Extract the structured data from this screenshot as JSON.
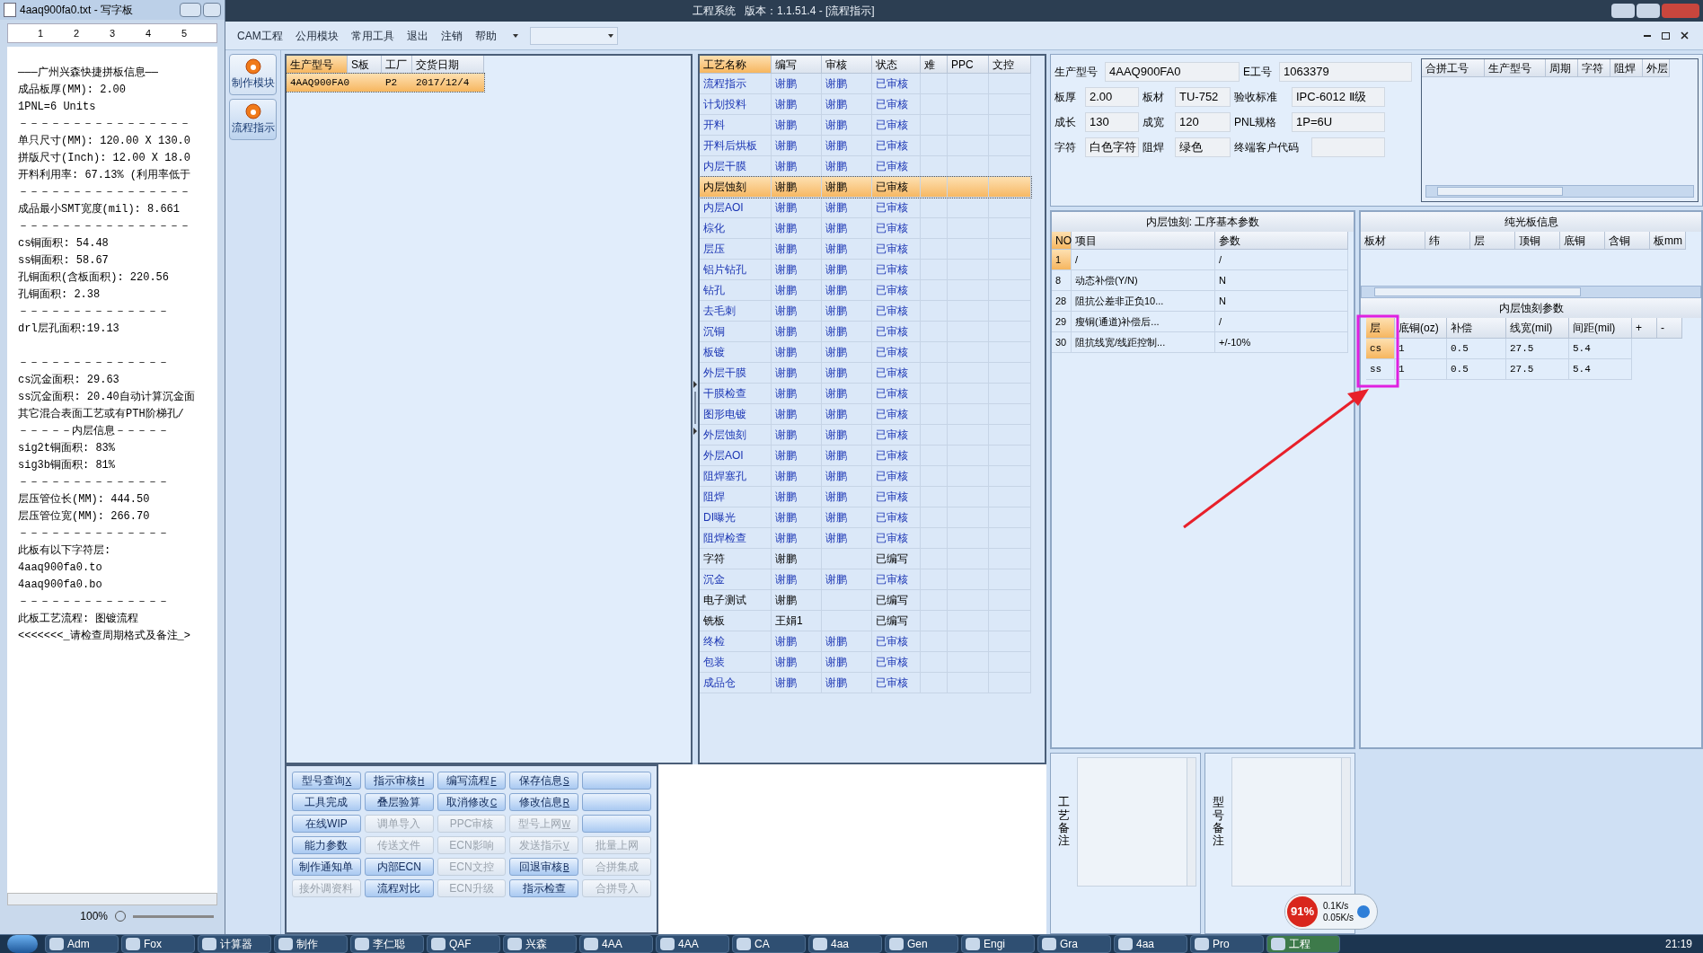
{
  "notepad": {
    "title": "4aaq900fa0.txt - 写字板",
    "ruler_marks": [
      "1",
      "2",
      "3",
      "4",
      "5"
    ],
    "lines": [
      {
        "text": "———广州兴森快捷拼板信息——"
      },
      {
        "text": "成品板厚(MM): 2.00"
      },
      {
        "text": "1PNL=6 Units"
      },
      {
        "text": "－－－－－－－－－－－－－－－－"
      },
      {
        "text": "单只尺寸(MM): 120.00 X 130.0"
      },
      {
        "text": "拼版尺寸(Inch): 12.00 X 18.0"
      },
      {
        "text": "开料利用率: 67.13% (利用率低于"
      },
      {
        "text": "－－－－－－－－－－－－－－－－"
      },
      {
        "text": "成品最小SMT宽度(mil): 8.661"
      },
      {
        "text": "－－－－－－－－－－－－－－－－"
      },
      {
        "text": "cs铜面积: 54.48"
      },
      {
        "text": "ss铜面积: 58.67"
      },
      {
        "text": "孔铜面积(含板面积): 220.56"
      },
      {
        "text": "孔铜面积: 2.38"
      },
      {
        "text": "－－－－－－－－－－－－－－"
      },
      {
        "text": "drl层孔面积:19.13"
      },
      {
        "text": "－－－－－－－－－－－－－－",
        "gap_before": true
      },
      {
        "text": "cs沉金面积: 29.63"
      },
      {
        "text": "ss沉金面积: 20.40自动计算沉金面"
      },
      {
        "text": "其它混合表面工艺或有PTH阶梯孔/"
      },
      {
        "text": "－－－－－内层信息－－－－－"
      },
      {
        "text": "sig2t铜面积: 83%"
      },
      {
        "text": "sig3b铜面积: 81%"
      },
      {
        "text": "－－－－－－－－－－－－－－"
      },
      {
        "text": "层压管位长(MM): 444.50"
      },
      {
        "text": "层压管位宽(MM): 266.70"
      },
      {
        "text": "－－－－－－－－－－－－－－"
      },
      {
        "text": "此板有以下字符层:"
      },
      {
        "text": "4aaq900fa0.to"
      },
      {
        "text": "4aaq900fa0.bo"
      },
      {
        "text": "－－－－－－－－－－－－－－"
      },
      {
        "text": "此板工艺流程: 图镀流程"
      },
      {
        "text": "<<<<<<<_请检查周期格式及备注_>"
      }
    ],
    "zoom": "100%"
  },
  "window": {
    "title": "工程系统   版本：1.1.51.4 - [流程指示]"
  },
  "menu": [
    "CAM工程",
    "公用模块",
    "常用工具",
    "退出",
    "注销",
    "帮助"
  ],
  "sidebar": [
    {
      "label": "制作模块",
      "selected": false
    },
    {
      "label": "流程指示",
      "selected": true
    }
  ],
  "product_list": {
    "columns": [
      "生产型号",
      "S板",
      "工厂",
      "交货日期"
    ],
    "rows": [
      {
        "cells": [
          "4AAQ900FA0",
          "",
          "P2",
          "2017/12/4"
        ],
        "selected": true
      }
    ]
  },
  "process_table": {
    "columns": [
      "工艺名称",
      "编写",
      "审核",
      "状态",
      "难",
      "PPC",
      "文控"
    ],
    "rows": [
      {
        "cells": [
          "流程指示",
          "谢鹏",
          "谢鹏",
          "已审核"
        ],
        "reviewed": true,
        "selected": false
      },
      {
        "cells": [
          "计划投料",
          "谢鹏",
          "谢鹏",
          "已审核"
        ],
        "reviewed": true,
        "selected": false
      },
      {
        "cells": [
          "开料",
          "谢鹏",
          "谢鹏",
          "已审核"
        ],
        "reviewed": true,
        "selected": false
      },
      {
        "cells": [
          "开料后烘板",
          "谢鹏",
          "谢鹏",
          "已审核"
        ],
        "reviewed": true,
        "selected": false
      },
      {
        "cells": [
          "内层干膜",
          "谢鹏",
          "谢鹏",
          "已审核"
        ],
        "reviewed": true,
        "selected": false
      },
      {
        "cells": [
          "内层蚀刻",
          "谢鹏",
          "谢鹏",
          "已审核"
        ],
        "reviewed": true,
        "selected": true
      },
      {
        "cells": [
          "内层AOI",
          "谢鹏",
          "谢鹏",
          "已审核"
        ],
        "reviewed": true,
        "selected": false
      },
      {
        "cells": [
          "棕化",
          "谢鹏",
          "谢鹏",
          "已审核"
        ],
        "reviewed": true,
        "selected": false
      },
      {
        "cells": [
          "层压",
          "谢鹏",
          "谢鹏",
          "已审核"
        ],
        "reviewed": true,
        "selected": false
      },
      {
        "cells": [
          "铝片钻孔",
          "谢鹏",
          "谢鹏",
          "已审核"
        ],
        "reviewed": true,
        "selected": false
      },
      {
        "cells": [
          "钻孔",
          "谢鹏",
          "谢鹏",
          "已审核"
        ],
        "reviewed": true,
        "selected": false
      },
      {
        "cells": [
          "去毛刺",
          "谢鹏",
          "谢鹏",
          "已审核"
        ],
        "reviewed": true,
        "selected": false
      },
      {
        "cells": [
          "沉铜",
          "谢鹏",
          "谢鹏",
          "已审核"
        ],
        "reviewed": true,
        "selected": false
      },
      {
        "cells": [
          "板镀",
          "谢鹏",
          "谢鹏",
          "已审核"
        ],
        "reviewed": true,
        "selected": false
      },
      {
        "cells": [
          "外层干膜",
          "谢鹏",
          "谢鹏",
          "已审核"
        ],
        "reviewed": true,
        "selected": false
      },
      {
        "cells": [
          "干膜检查",
          "谢鹏",
          "谢鹏",
          "已审核"
        ],
        "reviewed": true,
        "selected": false
      },
      {
        "cells": [
          "图形电镀",
          "谢鹏",
          "谢鹏",
          "已审核"
        ],
        "reviewed": true,
        "selected": false
      },
      {
        "cells": [
          "外层蚀刻",
          "谢鹏",
          "谢鹏",
          "已审核"
        ],
        "reviewed": true,
        "selected": false
      },
      {
        "cells": [
          "外层AOI",
          "谢鹏",
          "谢鹏",
          "已审核"
        ],
        "reviewed": true,
        "selected": false
      },
      {
        "cells": [
          "阻焊塞孔",
          "谢鹏",
          "谢鹏",
          "已审核"
        ],
        "reviewed": true,
        "selected": false
      },
      {
        "cells": [
          "阻焊",
          "谢鹏",
          "谢鹏",
          "已审核"
        ],
        "reviewed": true,
        "selected": false
      },
      {
        "cells": [
          "DI曝光",
          "谢鹏",
          "谢鹏",
          "已审核"
        ],
        "reviewed": true,
        "selected": false
      },
      {
        "cells": [
          "阻焊检查",
          "谢鹏",
          "谢鹏",
          "已审核"
        ],
        "reviewed": true,
        "selected": false
      },
      {
        "cells": [
          "字符",
          "谢鹏",
          "",
          "已编写"
        ],
        "reviewed": false,
        "selected": false
      },
      {
        "cells": [
          "沉金",
          "谢鹏",
          "谢鹏",
          "已审核"
        ],
        "reviewed": true,
        "selected": false
      },
      {
        "cells": [
          "电子测试",
          "谢鹏",
          "",
          "已编写"
        ],
        "reviewed": false,
        "selected": false
      },
      {
        "cells": [
          "铣板",
          "王娟1",
          "",
          "已编写"
        ],
        "reviewed": false,
        "selected": false
      },
      {
        "cells": [
          "终检",
          "谢鹏",
          "谢鹏",
          "已审核"
        ],
        "reviewed": true,
        "selected": false
      },
      {
        "cells": [
          "包装",
          "谢鹏",
          "谢鹏",
          "已审核"
        ],
        "reviewed": true,
        "selected": false
      },
      {
        "cells": [
          "成品仓",
          "谢鹏",
          "谢鹏",
          "已审核"
        ],
        "reviewed": true,
        "selected": false
      }
    ]
  },
  "button_grid": [
    [
      {
        "label": "型号查询",
        "shortcut": "X",
        "disabled": false
      },
      {
        "label": "指示审核",
        "shortcut": "H",
        "disabled": false
      },
      {
        "label": "编写流程",
        "shortcut": "F",
        "disabled": false
      },
      {
        "label": "保存信息",
        "shortcut": "S",
        "disabled": false
      },
      {
        "disabled": false
      }
    ],
    [
      {
        "label": "工具完成",
        "disabled": false
      },
      {
        "label": "叠层验算",
        "disabled": false
      },
      {
        "label": "取消修改",
        "shortcut": "C",
        "disabled": false
      },
      {
        "label": "修改信息",
        "shortcut": "R",
        "disabled": false
      },
      {
        "disabled": false
      }
    ],
    [
      {
        "label": "在线WIP",
        "disabled": false
      },
      {
        "label": "调单导入",
        "disabled": true
      },
      {
        "label": "PPC审核",
        "disabled": true
      },
      {
        "label": "型号上网",
        "shortcut": "W",
        "disabled": true
      },
      {
        "disabled": false
      }
    ],
    [
      {
        "label": "能力参数",
        "disabled": false
      },
      {
        "label": "传送文件",
        "disabled": true
      },
      {
        "label": "ECN影响",
        "disabled": true
      },
      {
        "label": "发送指示",
        "shortcut": "V",
        "disabled": true
      },
      {
        "label": "批量上网",
        "disabled": true
      }
    ],
    [
      {
        "label": "制作通知单",
        "disabled": false
      },
      {
        "label": "内部ECN",
        "disabled": false
      },
      {
        "label": "ECN文控",
        "disabled": true
      },
      {
        "label": "回退审核",
        "shortcut": "B",
        "disabled": false
      },
      {
        "label": "合拼集成",
        "disabled": true
      }
    ],
    [
      {
        "label": "接外调资料",
        "disabled": true
      },
      {
        "label": "流程对比",
        "disabled": false
      },
      {
        "label": "ECN升级",
        "disabled": true
      },
      {
        "label": "指示检查",
        "disabled": false
      },
      {
        "label": "合拼导入",
        "disabled": true
      }
    ]
  ],
  "info_form": [
    [
      {
        "label": "生产型号",
        "value": "4AAQ900FA0"
      },
      {
        "label": "E工号",
        "value": "1063379"
      }
    ],
    [
      {
        "label": "板厚",
        "value": "2.00"
      },
      {
        "label": "板材",
        "value": "TU-752"
      },
      {
        "label": "验收标准",
        "value": "IPC-6012 Ⅱ级"
      }
    ],
    [
      {
        "label": "成长",
        "value": "130"
      },
      {
        "label": "成宽",
        "value": "120"
      },
      {
        "label": "PNL规格",
        "value": "1P=6U"
      }
    ],
    [
      {
        "label": "字符",
        "value": "白色字符"
      },
      {
        "label": "阻焊",
        "value": "绿色"
      },
      {
        "label": "终端客户代码"
      }
    ]
  ],
  "merge_table": {
    "columns": [
      "合拼工号",
      "生产型号",
      "周期",
      "字符",
      "阻焊",
      "外层"
    ]
  },
  "params_panel": {
    "title": "内层蚀刻: 工序基本参数",
    "columns": [
      "NO",
      "项目",
      "参数"
    ],
    "rows": [
      {
        "cells": [
          "1",
          "/",
          "/"
        ],
        "selected": true
      },
      {
        "cells": [
          "8",
          "动态补偿(Y/N)",
          "N"
        ],
        "selected": false
      },
      {
        "cells": [
          "28",
          "阻抗公差非正负10...",
          "N"
        ],
        "selected": false
      },
      {
        "cells": [
          "29",
          "瘦铜(通道)补偿后...",
          "/"
        ],
        "selected": false
      },
      {
        "cells": [
          "30",
          "阻抗线宽/线距控制...",
          "+/-10%"
        ],
        "selected": false
      }
    ]
  },
  "bare_board": {
    "title": "纯光板信息",
    "columns": [
      "板材",
      "纬",
      "层",
      "顶铜",
      "底铜",
      "含铜",
      "板mm"
    ]
  },
  "etch_params": {
    "title": "内层蚀刻参数",
    "columns": [
      "层",
      "底铜(oz)",
      "补偿",
      "线宽(mil)",
      "间距(mil)",
      "+",
      "-"
    ],
    "rows": [
      {
        "cells": [
          "cs",
          "1",
          "0.5",
          "27.5",
          "5.4"
        ],
        "selected": true
      },
      {
        "cells": [
          "ss",
          "1",
          "0.5",
          "27.5",
          "5.4"
        ],
        "selected": false
      }
    ]
  },
  "notes": [
    {
      "label": "工艺备注"
    },
    {
      "label": "型号备注"
    }
  ],
  "net_monitor": {
    "percent": "91%",
    "up": "0.1K/s",
    "down": "0.05K/s"
  },
  "taskbar": {
    "items": [
      {
        "label": "Adm",
        "selected": false
      },
      {
        "label": "Fox",
        "selected": false
      },
      {
        "label": "计算器",
        "selected": false
      },
      {
        "label": "制作",
        "selected": false
      },
      {
        "label": "李仁聪",
        "selected": false
      },
      {
        "label": "QAF",
        "selected": false
      },
      {
        "label": "兴森",
        "selected": false
      },
      {
        "label": "4AA",
        "selected": false
      },
      {
        "label": "4AA",
        "selected": false
      },
      {
        "label": "CA",
        "selected": false
      },
      {
        "label": "4aa",
        "selected": false
      },
      {
        "label": "Gen",
        "selected": false
      },
      {
        "label": "Engi",
        "selected": false
      },
      {
        "label": "Gra",
        "selected": false
      },
      {
        "label": "4aa",
        "selected": false
      },
      {
        "label": "Pro",
        "selected": false
      },
      {
        "label": "工程",
        "selected": true
      }
    ],
    "clock": "21:19"
  }
}
